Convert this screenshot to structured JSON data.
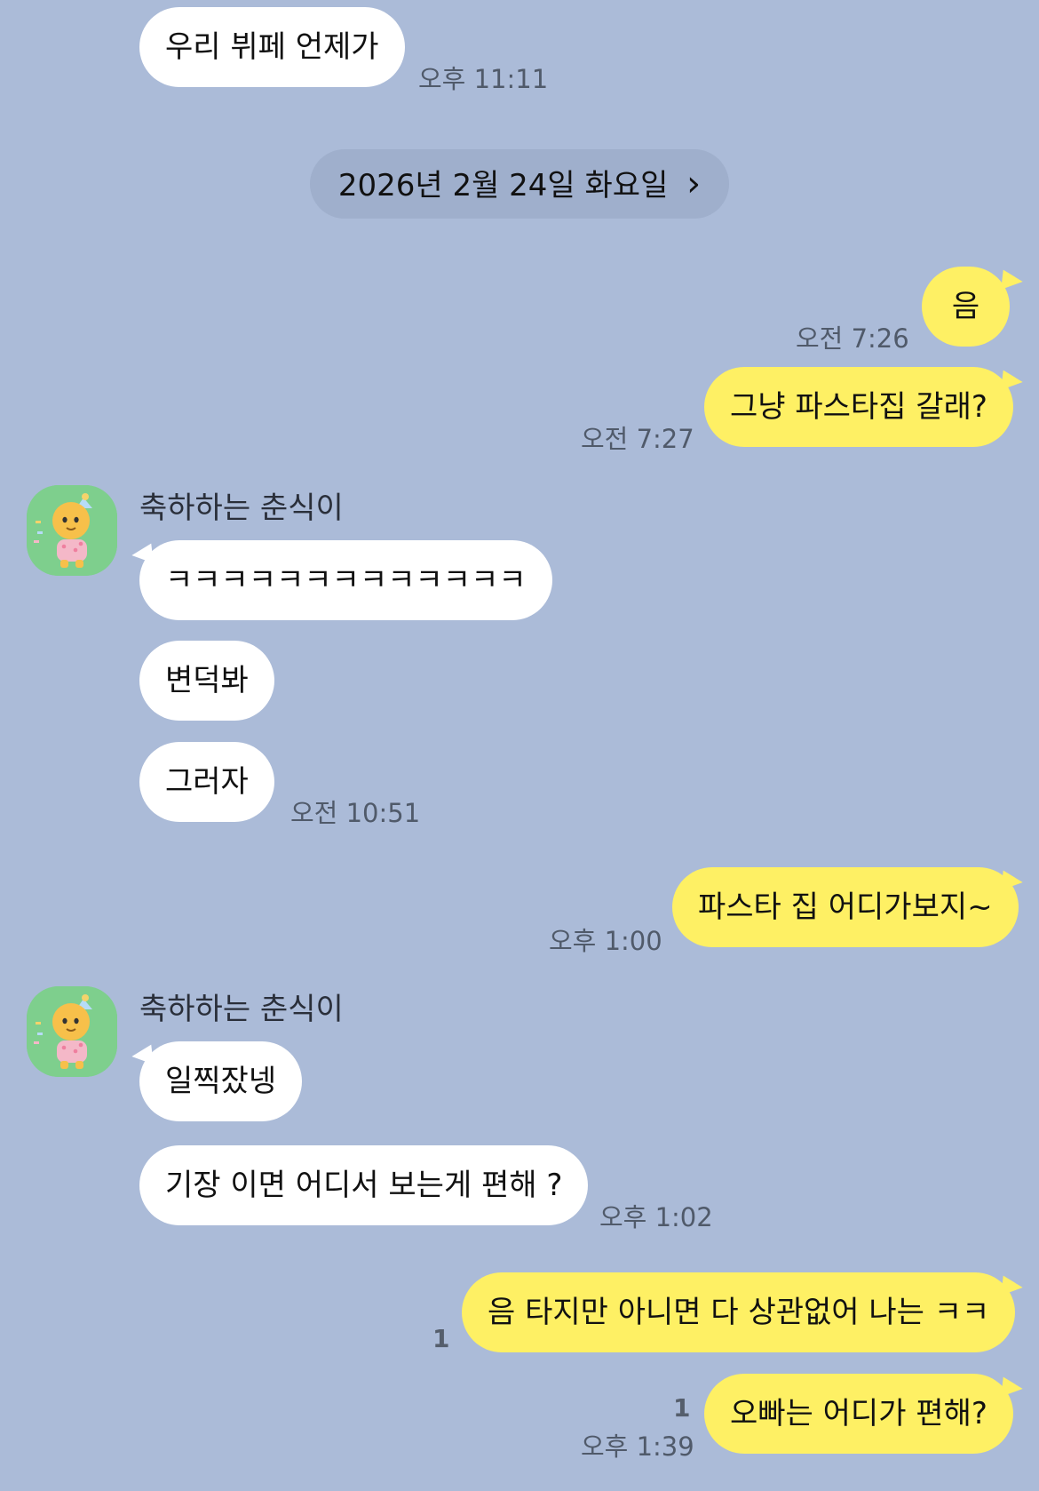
{
  "chat": {
    "date_divider": "2026년 2월 24일 화요일",
    "date_chevron": "›",
    "sender_name": "축하하는 춘식이",
    "m1": {
      "text": "우리 뷔페 언제가",
      "time": "오후 11:11"
    },
    "m2": {
      "text": "음",
      "time": "오전 7:26"
    },
    "m3": {
      "text": "그냥 파스타집 갈래?",
      "time": "오전 7:27"
    },
    "m4": {
      "text": "ㅋㅋㅋㅋㅋㅋㅋㅋㅋㅋㅋㅋㅋ"
    },
    "m5": {
      "text": "변덕봐"
    },
    "m6": {
      "text": "그러자",
      "time": "오전 10:51"
    },
    "m7": {
      "text": "파스타 집 어디가보지~",
      "time": "오후 1:00"
    },
    "m8": {
      "text": "일찍잤넹"
    },
    "m9": {
      "text": "기장 이면 어디서 보는게 편해 ?",
      "time": "오후 1:02"
    },
    "m10": {
      "text": "음 타지만 아니면 다 상관없어 나는 ㅋㅋ",
      "unread": "1"
    },
    "m11": {
      "text": "오빠는 어디가 편해?",
      "unread": "1",
      "time": "오후 1:39"
    }
  },
  "colors": {
    "background": "#abbbd8",
    "outgoing_bubble": "#fef064",
    "incoming_bubble": "#ffffff",
    "avatar_bg": "#7ecf8d"
  },
  "icons": {
    "avatar": "choonsik-character-icon",
    "chevron": "chevron-right-icon"
  }
}
